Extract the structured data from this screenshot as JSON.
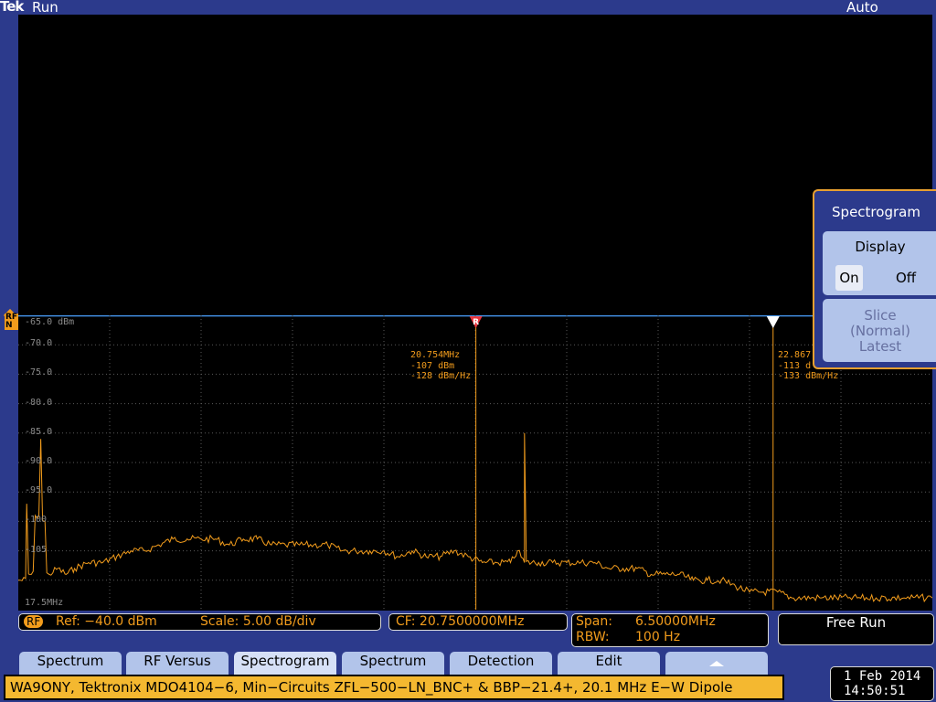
{
  "header": {
    "brand": "Tek",
    "run_state": "Run",
    "trigger_mode": "Auto"
  },
  "colors": {
    "trace": "#f29c1c",
    "marker_r": "#e8343c",
    "marker": "#f29c1c",
    "screen": "#000000",
    "frame": "#2c3a8c",
    "grid": "#5a5a5a"
  },
  "ref_marker": {
    "label": "RF\nN"
  },
  "y_axis": {
    "top_label": "-65.0 dBm",
    "ticks": [
      "-70.0",
      "-75.0",
      "-80.0",
      "-85.0",
      "-90.0",
      "-95.0",
      "-100",
      "-105"
    ]
  },
  "x_axis": {
    "start_label": "17.5MHz"
  },
  "markers": [
    {
      "id": "R",
      "freq": "20.754MHz",
      "level": "-107 dBm",
      "density": "-128 dBm/Hz"
    },
    {
      "id": "",
      "freq": "22.867",
      "level": "-113 d",
      "density": "-133 dBm/Hz"
    }
  ],
  "chart_data": {
    "type": "line",
    "xlabel": "",
    "ylabel": "",
    "xlim": [
      17.5,
      24.0
    ],
    "ylim": [
      -105.0,
      -65.0
    ],
    "series": [
      {
        "x": [
          17.5,
          17.56,
          17.58,
          17.62,
          17.66,
          17.69,
          17.72,
          17.78,
          17.84,
          17.9,
          18.0,
          18.1,
          18.2,
          18.3,
          18.4,
          18.5,
          18.6,
          18.7,
          18.8,
          18.9,
          19.0,
          19.1,
          19.2,
          19.3,
          19.4,
          19.5,
          19.6,
          19.7,
          19.8,
          19.9,
          20.0,
          20.1,
          20.2,
          20.3,
          20.4,
          20.5,
          20.6,
          20.7,
          20.8,
          20.9,
          21.0,
          21.05,
          21.1,
          21.1,
          21.2,
          21.3,
          21.4,
          21.5,
          21.6,
          21.7,
          21.8,
          21.9,
          22.0,
          22.1,
          22.2,
          22.3,
          22.4,
          22.5,
          22.6,
          22.7,
          22.8,
          22.9,
          23.0,
          23.2,
          23.4,
          23.6,
          23.8,
          24.0
        ],
        "y": [
          -110,
          -97,
          -109,
          -99,
          -86,
          -100,
          -109,
          -108,
          -109,
          -108,
          -107,
          -107,
          -106,
          -105,
          -105,
          -104,
          -103,
          -103,
          -103,
          -103,
          -104,
          -103,
          -103,
          -104,
          -104,
          -104,
          -104,
          -104,
          -105,
          -105,
          -105,
          -105,
          -106,
          -105,
          -106,
          -106,
          -105,
          -106,
          -107,
          -107,
          -107,
          -105,
          -107,
          -85,
          -107,
          -107,
          -107,
          -107,
          -107,
          -108,
          -108,
          -108,
          -109,
          -109,
          -109,
          -110,
          -110,
          -110,
          -111,
          -112,
          -112,
          -112,
          -113,
          -113,
          -113,
          -113,
          -113,
          -113
        ]
      }
    ]
  },
  "menu": {
    "title": "Spectrogram",
    "display_label": "Display",
    "display_on": "On",
    "display_off": "Off",
    "slice_line1": "Slice",
    "slice_line2": "(Normal)",
    "slice_line3": "Latest"
  },
  "status": {
    "rf_tag": "RF",
    "ref": "Ref: −40.0 dBm",
    "scale": "Scale: 5.00 dB/div",
    "cf": "CF:  20.7500000MHz",
    "span_label": "Span:",
    "span_value": "6.50000MHz",
    "rbw_label": "RBW:",
    "rbw_value": "100 Hz",
    "free_run": "Free Run"
  },
  "softkeys": [
    "Spectrum",
    "RF Versus",
    "Spectrogram",
    "Spectrum",
    "Detection",
    "Edit",
    ""
  ],
  "softkey_lines2": [
    "",
    "",
    "",
    "",
    "",
    "",
    ""
  ],
  "caption": "WA9ONY, Tektronix MDO4104−6, Min−Circuits ZFL−500−LN_BNC+ & BBP−21.4+, 20.1 MHz E−W Dipole",
  "datetime": {
    "date": "1 Feb  2014",
    "time": "14:50:51"
  }
}
